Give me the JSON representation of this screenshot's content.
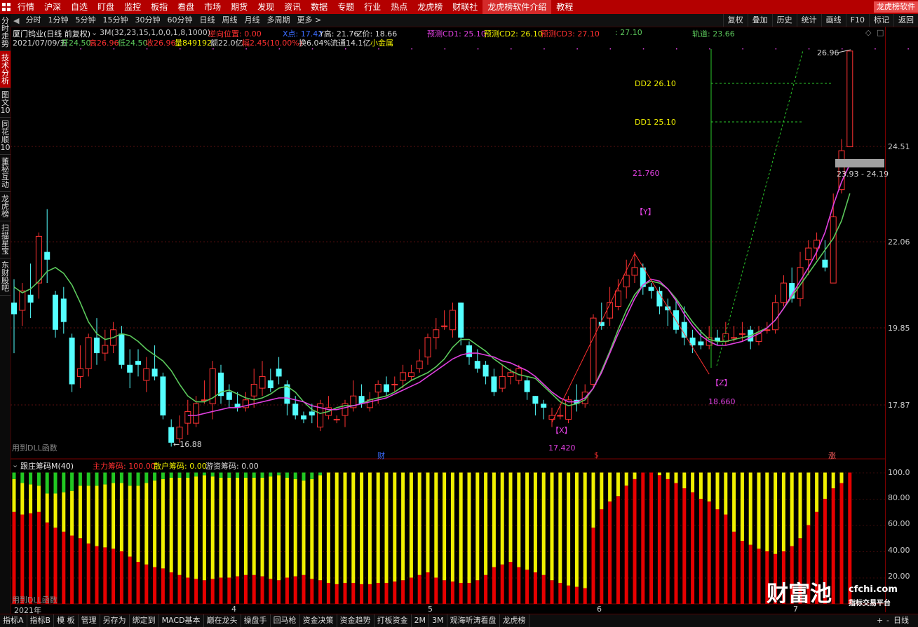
{
  "menubar": {
    "items": [
      "行情",
      "沪深",
      "自选",
      "盯盘",
      "监控",
      "板指",
      "看盘",
      "市场",
      "期货",
      "发现",
      "资讯",
      "数据",
      "专题",
      "行业",
      "热点",
      "龙虎榜",
      "财联社",
      "龙虎榜软件介绍",
      "教程"
    ],
    "brand": "龙虎榜软件"
  },
  "periodbar": {
    "items": [
      "分时",
      "1分钟",
      "5分钟",
      "15分钟",
      "30分钟",
      "60分钟",
      "日线",
      "周线",
      "月线",
      "多周期",
      "更多 >"
    ],
    "right": [
      "复权",
      "叠加",
      "历史",
      "统计",
      "画线",
      "F10",
      "标记",
      "返回"
    ]
  },
  "sidebar": {
    "tabs": [
      "分时走势",
      "技术分析",
      "图文10",
      "同花顺10",
      "董秘互动",
      "龙虎榜",
      "扫描星宝",
      "东财股吧"
    ]
  },
  "info": {
    "stock": "厦门钨业(日线 前复权)",
    "indicator_params": "3M(32,23,15,1,0,0,1,8,1000)",
    "reverse_pos": "逆向位置: 0.00",
    "x_val": "X点: 17.42",
    "y_val": "Y高: 21.76",
    "z_val": "Z价: 18.66",
    "cd1": "预测CD1: 25.10",
    "cd2": "预测CD2: 26.10",
    "cd3": "预测CD3: 27.10",
    "colon_val": ": 27.10",
    "track": "轨道: 23.66",
    "date": "2021/07/09/五",
    "open": "开24.50",
    "high": "高26.96",
    "low": "低24.50",
    "close": "收26.96",
    "volume": "量849192",
    "amount": "额22.0亿",
    "change": "幅2.45(10.00%)",
    "turnover": "换6.04%",
    "float": "流通14.1亿",
    "sector": "小金属"
  },
  "main_chart": {
    "price_ticks": [
      24.51,
      22.06,
      19.85,
      17.87
    ],
    "dd2": "DD2  26.10",
    "dd1": "DD1  25.10",
    "y_value": "21.760",
    "y_label": "【Y】",
    "x_label": "【X】",
    "x_value": "17.420",
    "z_label": "【Z】",
    "z_value": "18.660",
    "low_label": "←16.88",
    "high_label": "26.96",
    "range_label": "23.93 - 24.19",
    "dll_text": "用到DLL函数",
    "marker_cai": "财",
    "marker_s": "$",
    "marker_zhang": "涨",
    "candles": [
      [
        20.5,
        20.2,
        21.1,
        19.2
      ],
      [
        20.3,
        20.8,
        21.0,
        19.9
      ],
      [
        20.7,
        20.5,
        21.5,
        20.1
      ],
      [
        21.0,
        22.2,
        22.3,
        20.6
      ],
      [
        21.8,
        21.6,
        22.9,
        21.0
      ],
      [
        20.7,
        19.8,
        20.8,
        19.6
      ],
      [
        20.6,
        20.0,
        20.9,
        19.7
      ],
      [
        19.6,
        18.4,
        19.7,
        18.2
      ],
      [
        18.6,
        18.8,
        19.4,
        18.3
      ],
      [
        18.8,
        19.6,
        19.7,
        18.6
      ],
      [
        19.6,
        19.2,
        20.1,
        18.9
      ],
      [
        19.2,
        19.4,
        19.8,
        19.0
      ],
      [
        19.4,
        19.8,
        20.0,
        19.2
      ],
      [
        19.7,
        18.9,
        19.9,
        18.8
      ],
      [
        18.9,
        18.7,
        19.3,
        18.3
      ],
      [
        19.0,
        18.9,
        19.3,
        18.6
      ],
      [
        18.5,
        18.8,
        19.1,
        18.2
      ],
      [
        18.8,
        18.6,
        19.4,
        18.5
      ],
      [
        18.6,
        17.6,
        18.7,
        17.5
      ],
      [
        17.3,
        16.9,
        17.5,
        16.8
      ],
      [
        17.0,
        17.3,
        17.6,
        16.9
      ],
      [
        17.4,
        17.7,
        18.0,
        17.1
      ],
      [
        17.4,
        17.9,
        18.1,
        17.3
      ],
      [
        18.0,
        18.0,
        18.5,
        17.9
      ],
      [
        17.9,
        18.8,
        19.0,
        17.5
      ],
      [
        18.7,
        18.1,
        18.9,
        17.9
      ],
      [
        18.2,
        18.0,
        18.4,
        17.8
      ],
      [
        17.9,
        17.8,
        18.2,
        17.7
      ],
      [
        17.8,
        18.0,
        18.2,
        17.7
      ],
      [
        18.1,
        18.4,
        18.8,
        17.8
      ],
      [
        18.3,
        18.6,
        19.0,
        18.1
      ],
      [
        18.5,
        18.3,
        18.8,
        18.2
      ],
      [
        18.8,
        18.6,
        19.1,
        18.4
      ],
      [
        18.4,
        17.9,
        18.5,
        17.6
      ],
      [
        17.9,
        17.6,
        18.1,
        17.5
      ],
      [
        17.6,
        17.5,
        17.7,
        17.4
      ],
      [
        17.7,
        17.6,
        17.9,
        17.4
      ],
      [
        17.3,
        17.9,
        18.0,
        17.2
      ],
      [
        17.6,
        17.8,
        18.1,
        17.5
      ],
      [
        17.5,
        17.5,
        17.6,
        17.4
      ],
      [
        17.6,
        17.9,
        18.0,
        17.3
      ],
      [
        17.8,
        18.1,
        18.5,
        17.7
      ],
      [
        18.1,
        17.9,
        18.4,
        17.8
      ],
      [
        17.8,
        18.0,
        18.2,
        17.7
      ],
      [
        18.2,
        18.4,
        18.5,
        17.9
      ],
      [
        18.4,
        18.2,
        18.6,
        18.1
      ],
      [
        18.4,
        18.4,
        18.6,
        18.2
      ],
      [
        18.5,
        18.7,
        18.9,
        18.3
      ],
      [
        18.6,
        18.7,
        18.9,
        18.5
      ],
      [
        18.8,
        19.0,
        19.3,
        18.7
      ],
      [
        19.1,
        19.6,
        19.7,
        18.9
      ],
      [
        19.6,
        19.8,
        20.1,
        19.3
      ],
      [
        19.9,
        19.9,
        20.3,
        19.8
      ],
      [
        19.8,
        20.3,
        20.5,
        19.6
      ],
      [
        20.5,
        19.6,
        20.5,
        19.4
      ],
      [
        19.4,
        19.1,
        19.5,
        18.9
      ],
      [
        19.0,
        18.8,
        19.3,
        18.7
      ],
      [
        18.9,
        18.6,
        19.0,
        18.4
      ],
      [
        18.6,
        18.2,
        18.8,
        18.1
      ],
      [
        18.3,
        18.6,
        18.9,
        18.2
      ],
      [
        18.6,
        18.7,
        18.8,
        18.4
      ],
      [
        18.5,
        18.8,
        18.9,
        18.4
      ],
      [
        18.5,
        18.2,
        18.6,
        18.0
      ],
      [
        18.1,
        17.9,
        18.1,
        17.6
      ],
      [
        17.9,
        17.8,
        18.0,
        17.5
      ],
      [
        17.5,
        17.6,
        17.8,
        17.3
      ],
      [
        17.6,
        17.6,
        17.9,
        17.5
      ],
      [
        17.5,
        18.0,
        18.1,
        17.4
      ],
      [
        18.0,
        17.9,
        18.4,
        17.7
      ],
      [
        17.9,
        18.2,
        18.4,
        17.8
      ],
      [
        18.4,
        20.1,
        20.2,
        18.3
      ],
      [
        20.0,
        19.9,
        20.5,
        19.8
      ],
      [
        20.1,
        20.5,
        20.9,
        19.9
      ],
      [
        20.4,
        20.8,
        21.1,
        20.3
      ],
      [
        20.9,
        21.2,
        21.6,
        20.6
      ],
      [
        21.2,
        21.4,
        21.8,
        21.0
      ],
      [
        21.4,
        20.9,
        21.5,
        20.7
      ],
      [
        20.9,
        20.8,
        21.0,
        20.6
      ],
      [
        20.8,
        20.4,
        20.9,
        20.2
      ],
      [
        20.4,
        20.3,
        20.6,
        19.9
      ],
      [
        20.3,
        19.8,
        20.6,
        19.7
      ],
      [
        20.0,
        19.6,
        20.4,
        19.4
      ],
      [
        19.6,
        19.4,
        19.8,
        19.2
      ],
      [
        19.5,
        19.4,
        19.8,
        19.3
      ],
      [
        19.4,
        19.6,
        19.9,
        19.3
      ],
      [
        19.6,
        19.5,
        19.8,
        19.4
      ],
      [
        19.5,
        19.7,
        20.0,
        19.4
      ],
      [
        19.6,
        19.6,
        19.9,
        19.5
      ],
      [
        19.7,
        19.7,
        20.0,
        19.5
      ],
      [
        19.8,
        19.5,
        19.9,
        19.3
      ],
      [
        19.5,
        19.7,
        19.9,
        19.4
      ],
      [
        19.8,
        19.8,
        20.0,
        19.7
      ],
      [
        19.8,
        20.5,
        20.7,
        19.7
      ],
      [
        20.5,
        21.0,
        21.2,
        20.4
      ],
      [
        21.0,
        20.6,
        21.4,
        20.5
      ],
      [
        20.6,
        21.4,
        21.8,
        20.4
      ],
      [
        21.6,
        21.9,
        22.1,
        21.2
      ],
      [
        21.9,
        22.1,
        22.3,
        21.6
      ],
      [
        21.6,
        21.4,
        22.1,
        21.3
      ],
      [
        21.0,
        22.7,
        23.3,
        21.0
      ],
      [
        23.4,
        24.4,
        24.7,
        23.3
      ],
      [
        24.5,
        26.96,
        26.96,
        24.5
      ]
    ],
    "ma_green": [
      20.9,
      20.75,
      20.85,
      21.05,
      21.3,
      21.4,
      21.25,
      20.95,
      20.5,
      20.0,
      19.7,
      19.55,
      19.6,
      19.7,
      19.65,
      19.5,
      19.3,
      19.15,
      19.0,
      18.75,
      18.4,
      18.1,
      17.95,
      17.95,
      18.05,
      18.2,
      18.25,
      18.15,
      18.05,
      18.0,
      18.05,
      18.15,
      18.3,
      18.35,
      18.2,
      17.95,
      17.75,
      17.65,
      17.7,
      17.8,
      17.85,
      17.85,
      17.9,
      18.0,
      18.05,
      18.1,
      18.2,
      18.35,
      18.5,
      18.6,
      18.7,
      18.85,
      19.05,
      19.35,
      19.55,
      19.55,
      19.4,
      19.25,
      19.05,
      18.9,
      18.75,
      18.65,
      18.6,
      18.55,
      18.35,
      18.15,
      17.95,
      17.85,
      17.9,
      18.0,
      18.3,
      18.75,
      19.25,
      19.8,
      20.3,
      20.7,
      20.95,
      21.05,
      21.0,
      20.85,
      20.6,
      20.3,
      20.0,
      19.75,
      19.55,
      19.5,
      19.5,
      19.55,
      19.6,
      19.65,
      19.75,
      19.85,
      20.05,
      20.35,
      20.65,
      20.95,
      21.25,
      21.55,
      21.85,
      22.15,
      22.6,
      23.3
    ],
    "ma_purple": [
      null,
      null,
      null,
      null,
      null,
      null,
      null,
      null,
      null,
      null,
      null,
      null,
      null,
      null,
      null,
      null,
      null,
      null,
      null,
      null,
      null,
      17.6,
      17.6,
      17.65,
      17.7,
      17.75,
      17.8,
      17.8,
      17.85,
      17.9,
      17.95,
      18.0,
      18.05,
      18.05,
      18.0,
      17.95,
      17.85,
      17.8,
      17.75,
      17.75,
      17.8,
      17.85,
      17.9,
      17.95,
      18.0,
      18.05,
      18.15,
      18.25,
      18.35,
      18.45,
      18.6,
      18.75,
      18.9,
      19.05,
      19.15,
      19.2,
      19.2,
      19.15,
      19.1,
      19.0,
      18.95,
      18.85,
      18.75,
      18.6,
      18.4,
      18.2,
      18.05,
      17.95,
      17.95,
      18.05,
      18.3,
      18.7,
      19.2,
      19.7,
      20.15,
      20.6,
      20.95,
      21.1,
      21.05,
      20.85,
      20.55,
      20.2,
      19.9,
      19.65,
      19.5,
      19.4,
      19.4,
      19.45,
      19.5,
      19.6,
      19.7,
      19.85,
      20.05,
      20.35,
      20.7,
      21.05,
      21.4,
      21.8,
      22.3,
      23.0,
      23.6,
      24.05
    ],
    "small_dots": [
      2,
      6,
      10,
      14,
      18,
      22,
      26,
      30,
      34,
      38,
      42,
      46,
      50,
      54,
      58,
      62,
      66,
      70,
      74,
      78,
      82,
      86,
      90,
      94,
      98,
      102
    ]
  },
  "sub_chart": {
    "title": "跟庄筹码M(40)",
    "main_force": "主力筹码: 100.00",
    "retail": "散户筹码: 0.00",
    "hot_money": "游资筹码: 0.00",
    "ticks": [
      "100.0",
      "80.00",
      "60.00",
      "40.00",
      "20.00"
    ],
    "red": [
      70,
      68,
      69,
      70,
      62,
      58,
      55,
      52,
      50,
      46,
      44,
      43,
      42,
      40,
      36,
      32,
      30,
      28,
      27,
      24,
      22,
      20,
      19,
      18,
      19,
      20,
      20,
      21,
      22,
      22,
      21,
      19,
      18,
      20,
      21,
      22,
      19,
      18,
      16,
      15,
      16,
      16,
      15,
      15,
      16,
      16,
      17,
      18,
      20,
      22,
      24,
      20,
      18,
      17,
      16,
      16,
      18,
      22,
      28,
      30,
      32,
      28,
      26,
      24,
      22,
      18,
      16,
      14,
      13,
      12,
      58,
      72,
      78,
      82,
      90,
      95,
      100,
      100,
      98,
      95,
      92,
      88,
      85,
      80,
      78,
      72,
      68,
      55,
      48,
      45,
      42,
      40,
      38,
      40,
      44,
      50,
      60,
      70,
      80,
      88,
      92,
      100
    ],
    "yellow": [
      25,
      24,
      22,
      20,
      22,
      26,
      30,
      34,
      40,
      44,
      46,
      48,
      50,
      52,
      54,
      58,
      62,
      66,
      68,
      72,
      74,
      76,
      78,
      80,
      78,
      76,
      76,
      75,
      74,
      74,
      75,
      78,
      80,
      76,
      74,
      72,
      76,
      80,
      84,
      85,
      84,
      84,
      85,
      85,
      84,
      84,
      83,
      82,
      80,
      78,
      76,
      80,
      82,
      83,
      84,
      84,
      82,
      78,
      72,
      70,
      68,
      72,
      74,
      76,
      78,
      82,
      84,
      86,
      87,
      88,
      42,
      28,
      22,
      18,
      10,
      5,
      0,
      0,
      2,
      5,
      8,
      12,
      15,
      20,
      22,
      28,
      32,
      45,
      52,
      55,
      58,
      60,
      62,
      60,
      56,
      50,
      40,
      30,
      20,
      12,
      8,
      0
    ],
    "date_labels": [
      "2021年",
      "4",
      "5",
      "6",
      "7"
    ],
    "date_indices": [
      1,
      25,
      49,
      73,
      97
    ]
  },
  "bottombar": {
    "items": [
      "指标A",
      "指标B",
      "模 板",
      "管理",
      "另存为",
      "绑定到",
      "MACD基本",
      "巅在龙头",
      "操盘手",
      "回马枪",
      "资金决策",
      "资金趋势",
      "打板资金",
      "2M",
      "3M",
      "观海听涛看盘",
      "龙虎榜"
    ],
    "right_label": "日线"
  },
  "watermark": {
    "logo": "财富池",
    "url": "cfchi.com",
    "slogan": "指标交易平台"
  },
  "colors": {
    "up": "#ff3232",
    "down": "#54ffff",
    "ma_green": "#5bc85b",
    "ma_purple": "#e040e0",
    "bar_red": "#e60000",
    "bar_yellow": "#f0f000",
    "bar_green": "#22c822"
  }
}
